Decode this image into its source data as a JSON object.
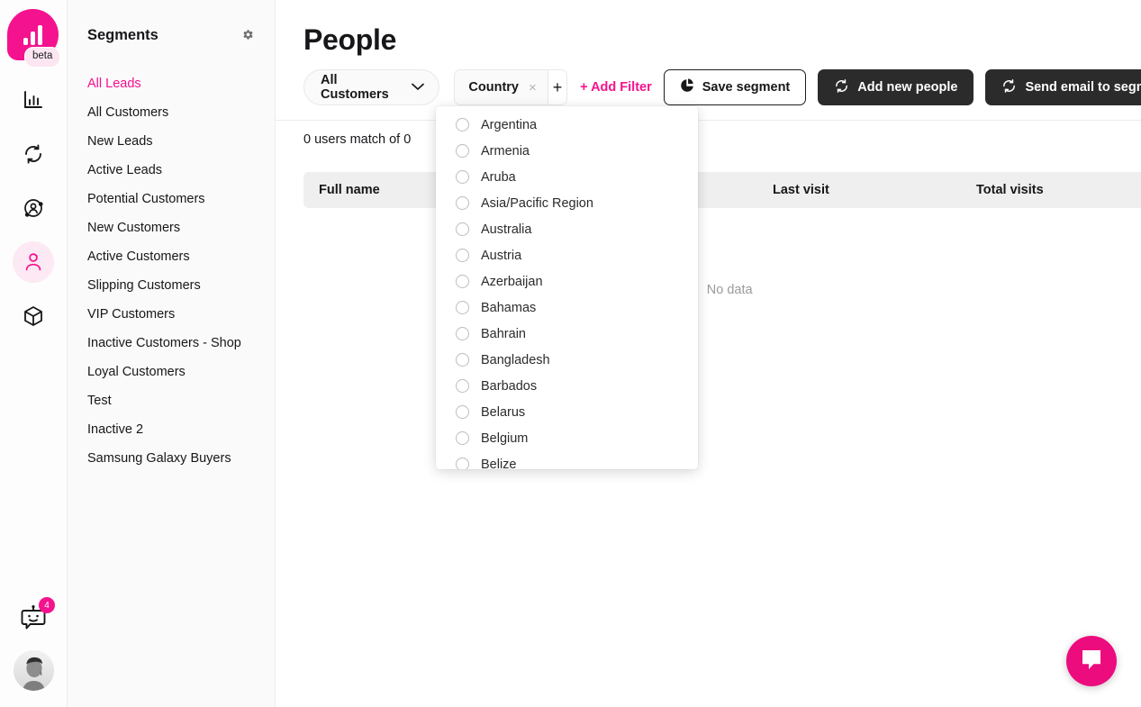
{
  "brand": {
    "accent": "#f5128e",
    "dark": "#2b2b2b",
    "beta_label": "beta"
  },
  "icon_rail": {
    "items": [
      {
        "name": "analytics-icon",
        "label": "Analytics"
      },
      {
        "name": "sync-icon",
        "label": "Sync"
      },
      {
        "name": "audience-icon",
        "label": "Audience"
      },
      {
        "name": "people-icon",
        "label": "People"
      },
      {
        "name": "products-icon",
        "label": "Products"
      }
    ],
    "bot_badge_count": "4"
  },
  "sidebar": {
    "title": "Segments",
    "settings_icon": "gear-icon",
    "items": [
      {
        "label": "All Leads",
        "active": true
      },
      {
        "label": "All Customers",
        "active": false
      },
      {
        "label": "New Leads",
        "active": false
      },
      {
        "label": "Active Leads",
        "active": false
      },
      {
        "label": "Potential Customers",
        "active": false
      },
      {
        "label": "New Customers",
        "active": false
      },
      {
        "label": "Active Customers",
        "active": false
      },
      {
        "label": "Slipping Customers",
        "active": false
      },
      {
        "label": "VIP Customers",
        "active": false
      },
      {
        "label": "Inactive Customers - Shop",
        "active": false
      },
      {
        "label": "Loyal Customers",
        "active": false
      },
      {
        "label": "Test",
        "active": false
      },
      {
        "label": "Inactive 2",
        "active": false
      },
      {
        "label": "Samsung Galaxy Buyers",
        "active": false
      }
    ]
  },
  "header": {
    "title": "People"
  },
  "toolbar": {
    "audience_select": "All Customers",
    "filter_chip": "Country",
    "filter_chip_remove": "×",
    "filter_add_plus": "+",
    "add_filter": "+ Add Filter",
    "save_segment": "Save segment",
    "add_new_people": "Add new people",
    "send_email": "Send email to segment"
  },
  "main": {
    "match_text": "0 users match of 0",
    "table_headers": [
      "Full name",
      "Last visit",
      "Total visits"
    ],
    "empty_state": "No data"
  },
  "dropdown": {
    "options": [
      "Argentina",
      "Armenia",
      "Aruba",
      "Asia/Pacific Region",
      "Australia",
      "Austria",
      "Azerbaijan",
      "Bahamas",
      "Bahrain",
      "Bangladesh",
      "Barbados",
      "Belarus",
      "Belgium",
      "Belize"
    ]
  },
  "chat": {
    "icon": "chat-bubble-icon"
  }
}
